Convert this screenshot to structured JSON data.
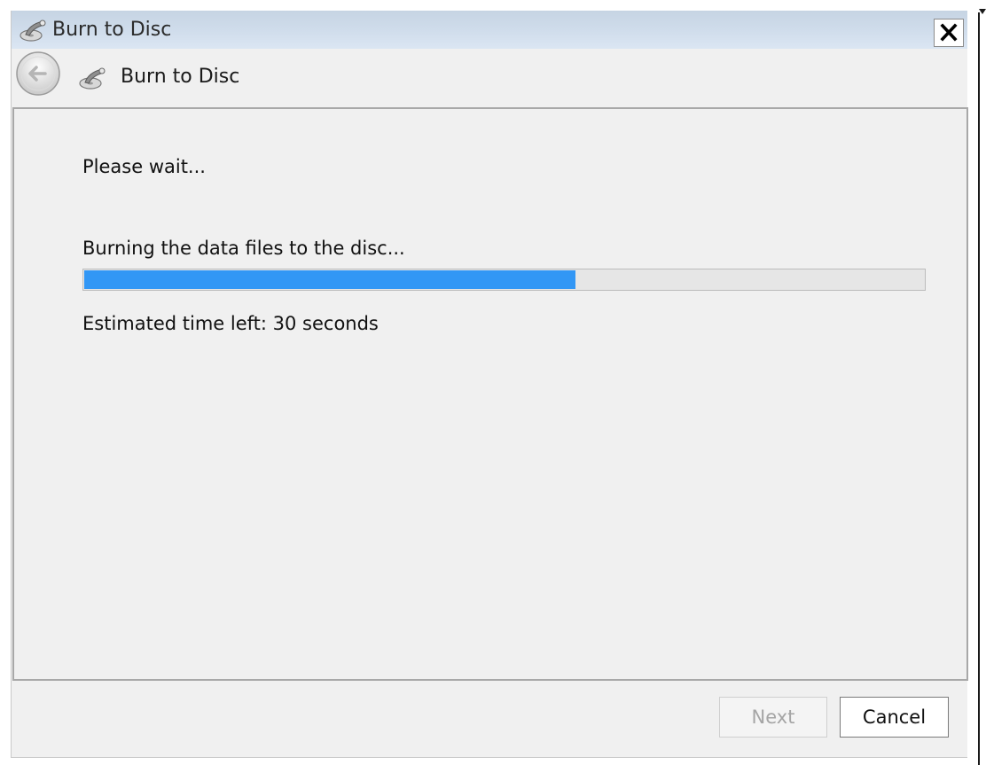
{
  "window": {
    "title": "Burn to Disc",
    "close_glyph": "✕"
  },
  "nav": {
    "title": "Burn to Disc",
    "back_icon": "back-arrow-icon",
    "disc_icon": "burn-disc-icon"
  },
  "content": {
    "status_heading": "Please wait...",
    "operation_text": "Burning the data files to the disc...",
    "progress_fraction": 0.585,
    "time_left": "Estimated time left: 30 seconds"
  },
  "buttons": {
    "next_label": "Next",
    "cancel_label": "Cancel"
  },
  "colors": {
    "progress_fill": "#3297f5",
    "titlebar": "#cfdceb",
    "background": "#f0f0f0"
  }
}
